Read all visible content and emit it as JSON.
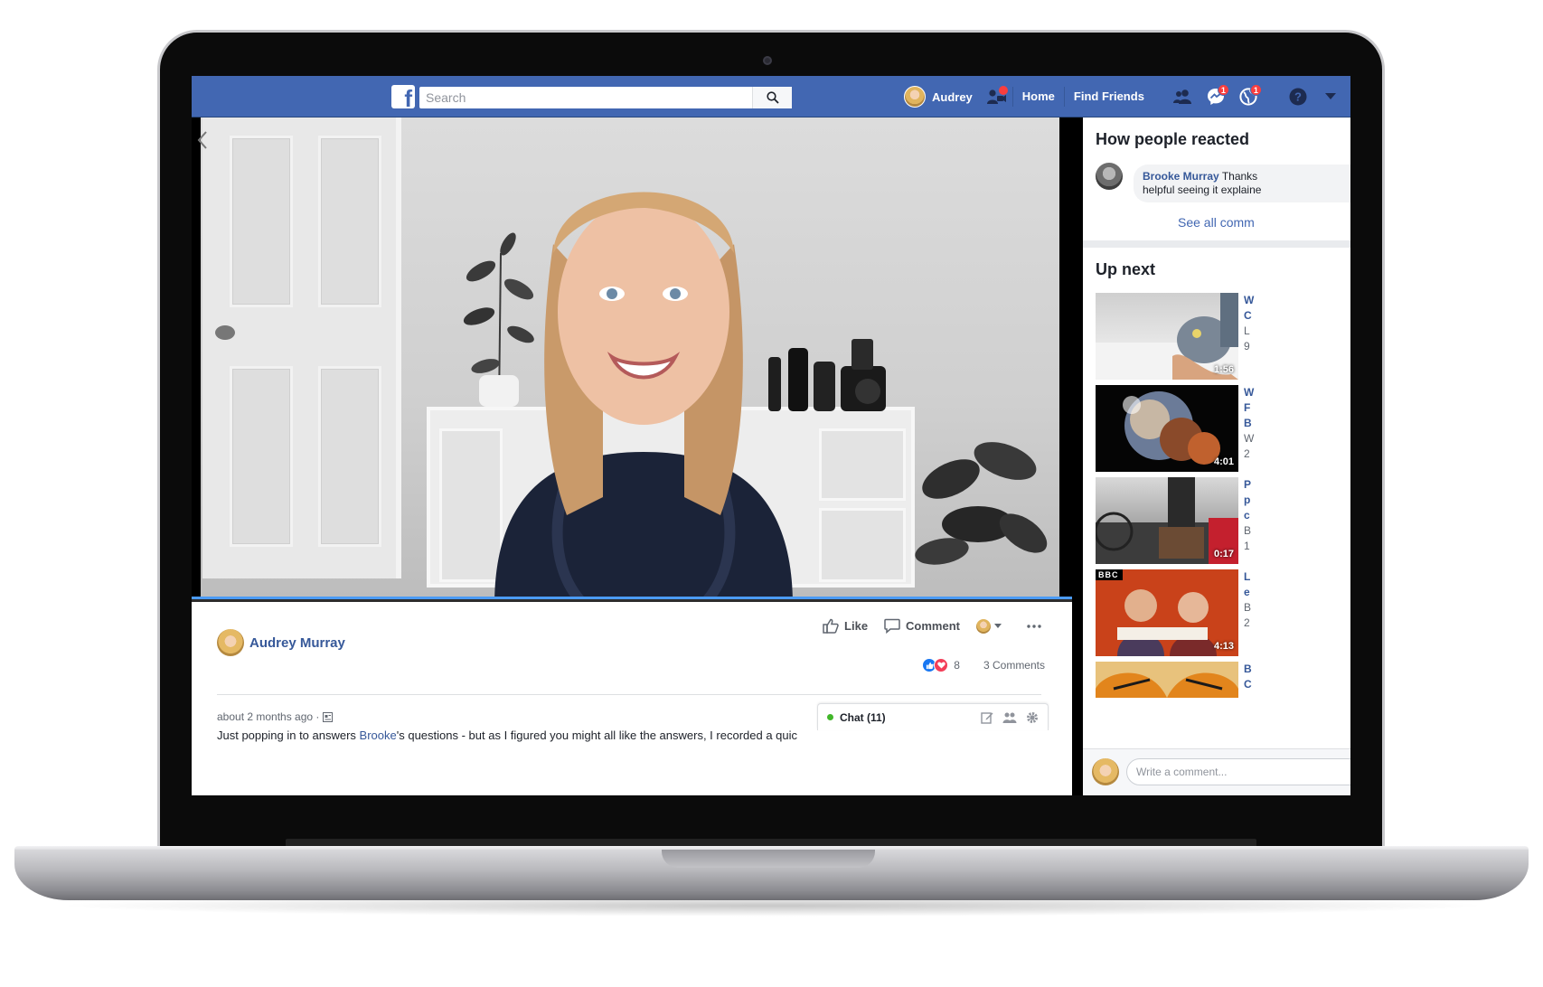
{
  "nav": {
    "logo_letter": "f",
    "search_placeholder": "Search",
    "user_name": "Audrey",
    "home_label": "Home",
    "find_friends_label": "Find Friends",
    "messages_badge": "1",
    "notifications_badge": "1"
  },
  "video": {
    "progress_fraction": 1.0
  },
  "post": {
    "author_name": "Audrey Murray",
    "like_label": "Like",
    "comment_label": "Comment",
    "reaction_count": "8",
    "comments_count_label": "3 Comments",
    "timestamp": "about 2 months ago ·",
    "caption_before": "Just popping in to answers ",
    "caption_mention": "Brooke",
    "caption_after": "'s questions - but as I figured you might all like the answers, I recorded a quic"
  },
  "chat": {
    "label": "Chat (11)"
  },
  "reactions_card": {
    "title": "How people reacted",
    "commenter": "Brooke Murray",
    "comment_line1": " Thanks",
    "comment_line2": "helpful seeing it explaine",
    "see_all": "See all comm"
  },
  "up_next": {
    "title": "Up next",
    "items": [
      {
        "duration": "1:56",
        "meta": [
          "W",
          "C",
          "L",
          "9"
        ]
      },
      {
        "duration": "4:01",
        "meta": [
          "W",
          "F",
          "B",
          "W",
          "2"
        ]
      },
      {
        "duration": "0:17",
        "meta": [
          "P",
          "p",
          "c",
          "B",
          "1"
        ]
      },
      {
        "duration": "4:13",
        "meta": [
          "L",
          "e",
          "B",
          "2"
        ],
        "channel_badge": "BBC"
      },
      {
        "duration": "",
        "meta": [
          "B",
          "C"
        ]
      }
    ]
  },
  "write_comment": {
    "placeholder": "Write a comment..."
  },
  "colors": {
    "fb_blue": "#4267b2",
    "link_blue": "#365899",
    "badge_red": "#fa3e3e",
    "online_green": "#42b72a"
  }
}
